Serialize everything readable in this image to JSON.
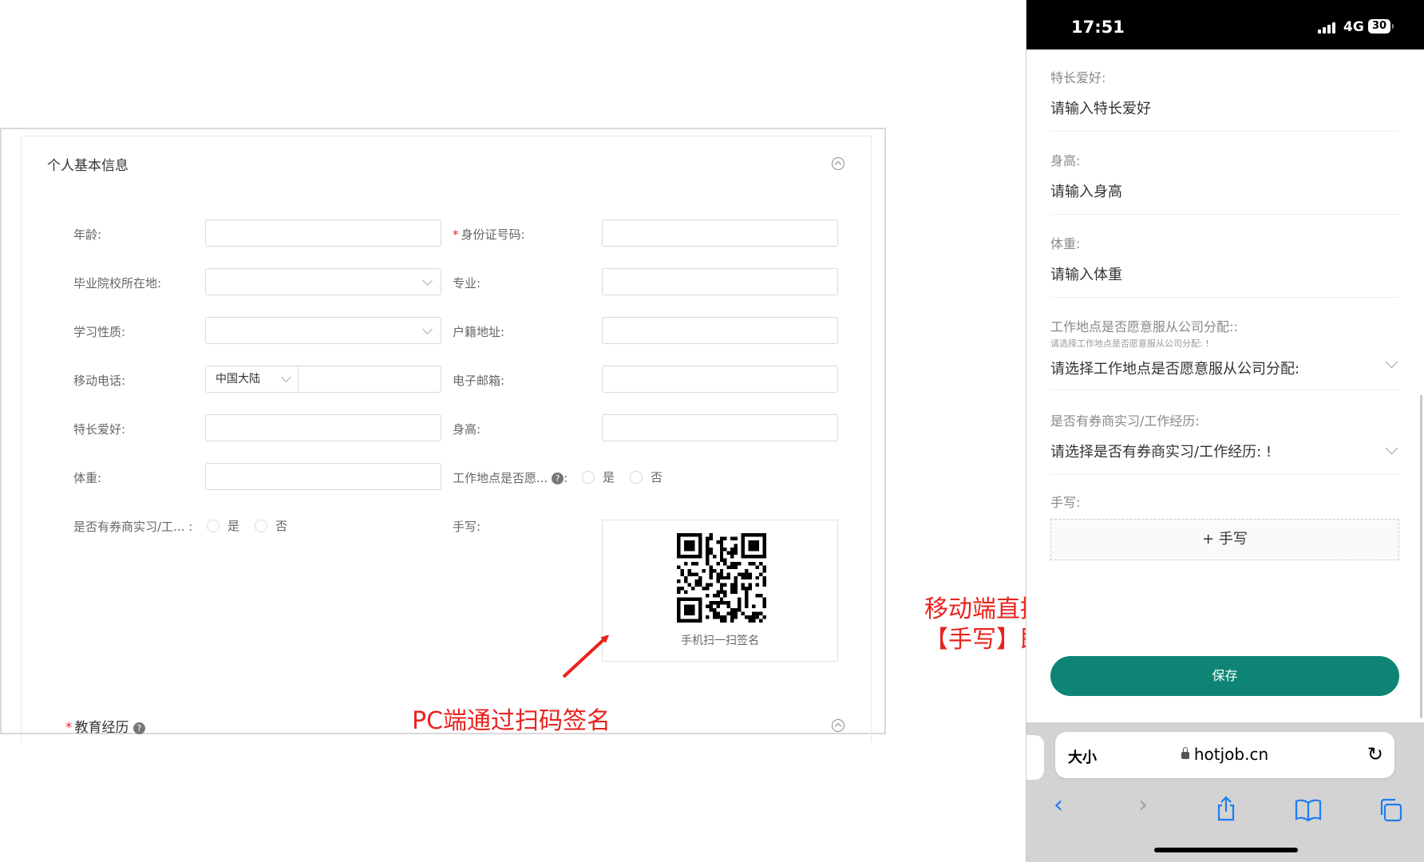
{
  "pc": {
    "section_title": "个人基本信息",
    "fields": {
      "age": "年龄:",
      "id_number": "身份证号码:",
      "school_location": "毕业院校所在地:",
      "major": "专业:",
      "study_type": "学习性质:",
      "household_address": "户籍地址:",
      "mobile": "移动电话:",
      "mobile_region": "中国大陆",
      "email": "电子邮箱:",
      "hobbies": "特长爱好:",
      "height": "身高:",
      "weight": "体重:",
      "work_location": "工作地点是否愿...",
      "brokerage_experience": "是否有券商实习/工...",
      "handwriting": "手写:"
    },
    "radio_yes": "是",
    "radio_no": "否",
    "help_glyph": "?",
    "qr_caption": "手机扫一扫签名",
    "education_title": "教育经历"
  },
  "annotations": {
    "pc_note": "PC端通过扫码签名",
    "mobile_note_line1": "移动端直接点击",
    "mobile_note_line2": "【手写】即可签名"
  },
  "mobile": {
    "status": {
      "time": "17:51",
      "network": "4G",
      "battery": "30"
    },
    "fields": [
      {
        "label": "特长爱好:",
        "placeholder": "请输入特长爱好"
      },
      {
        "label": "身高:",
        "placeholder": "请输入身高"
      },
      {
        "label": "体重:",
        "placeholder": "请输入体重"
      }
    ],
    "work_location": {
      "label": "工作地点是否愿意服从公司分配::",
      "hint": "请选择工作地点是否愿意服从公司分配: !",
      "placeholder": "请选择工作地点是否愿意服从公司分配:"
    },
    "experience": {
      "label": "是否有券商实习/工作经历:",
      "placeholder": "请选择是否有券商实习/工作经历: !"
    },
    "handwriting_label": "手写:",
    "handwriting_button": "+ 手写",
    "save_button": "保存",
    "browser": {
      "text_size": "大小",
      "url": "hotjob.cn"
    }
  },
  "colors": {
    "accent_green": "#0e8574",
    "annotation_red": "#e8231e",
    "required_red": "#f5222d"
  }
}
